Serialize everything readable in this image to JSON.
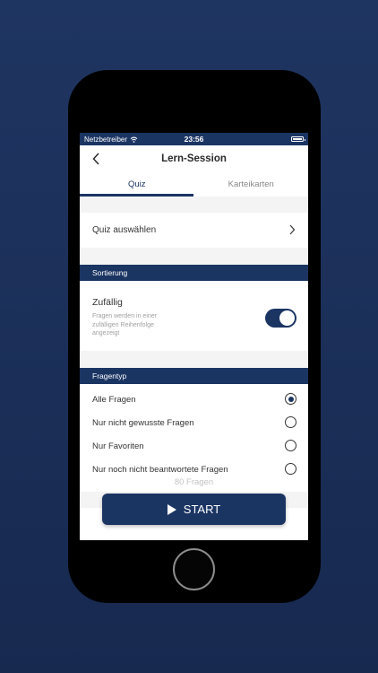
{
  "statusbar": {
    "carrier": "Netzbetreiber",
    "time": "23:56"
  },
  "navbar": {
    "title": "Lern-Session"
  },
  "tabs": [
    {
      "label": "Quiz",
      "active": true
    },
    {
      "label": "Karteikarten",
      "active": false
    }
  ],
  "quiz_select": {
    "label": "Quiz auswählen"
  },
  "sorting": {
    "header": "Sortierung",
    "option": "Zufällig",
    "description": "Fragen werden in einer zufälligen Reihenfolge angezeigt",
    "enabled": true
  },
  "question_type": {
    "header": "Fragentyp",
    "options": [
      {
        "label": "Alle Fragen",
        "selected": true
      },
      {
        "label": "Nur nicht gewusste Fragen",
        "selected": false
      },
      {
        "label": "Nur Favoriten",
        "selected": false
      },
      {
        "label": "Nur noch nicht beantwortete Fragen",
        "selected": false
      }
    ]
  },
  "question_count": "80 Fragen",
  "start_button": {
    "label": "START"
  },
  "colors": {
    "primary": "#1b3563",
    "background": "#1f3561"
  }
}
